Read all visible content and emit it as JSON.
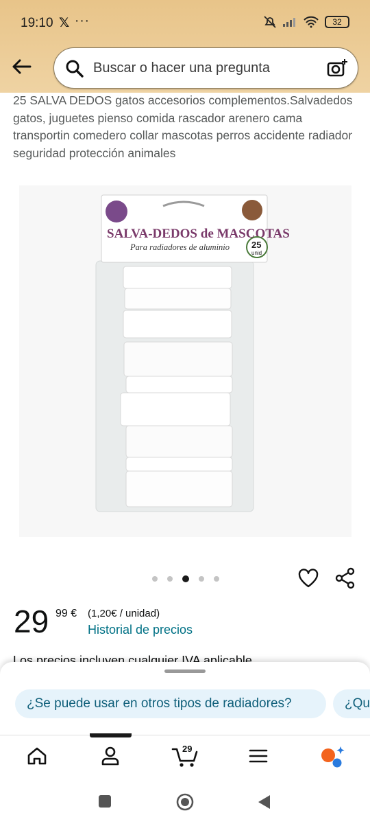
{
  "status_bar": {
    "time": "19:10",
    "battery": "32"
  },
  "search": {
    "placeholder": "Buscar o hacer una pregunta"
  },
  "product": {
    "title": "25 SALVA DEDOS gatos accesorios complementos.Salvadedos gatos, juguetes pienso comida rascador arenero cama transportin comedero collar mascotas perros accidente radiador seguridad protección animales",
    "image": {
      "brand": "SALVA-DEDOS de MASCOTAS",
      "tagline": "Para radiadores de aluminio",
      "badge_number": "25",
      "badge_unit": "unid"
    },
    "carousel": {
      "count": 5,
      "active_index": 2
    },
    "price": {
      "whole": "29",
      "fraction": "99 €",
      "unit_price": "(1,20€ / unidad)",
      "history_link": "Historial de precios"
    },
    "iva_note": "Los precios incluyen cualquier IVA aplicable."
  },
  "suggestions": [
    "¿Se puede usar en otros tipos de radiadores?",
    "¿Qué"
  ],
  "bottom_nav": {
    "cart_count": "29",
    "items": [
      "home-icon",
      "account-icon",
      "cart-icon",
      "menu-icon",
      "rufus-icon"
    ]
  },
  "colors": {
    "header": "#e8c489",
    "link": "#007185",
    "chip_bg": "#e6f3fb"
  }
}
